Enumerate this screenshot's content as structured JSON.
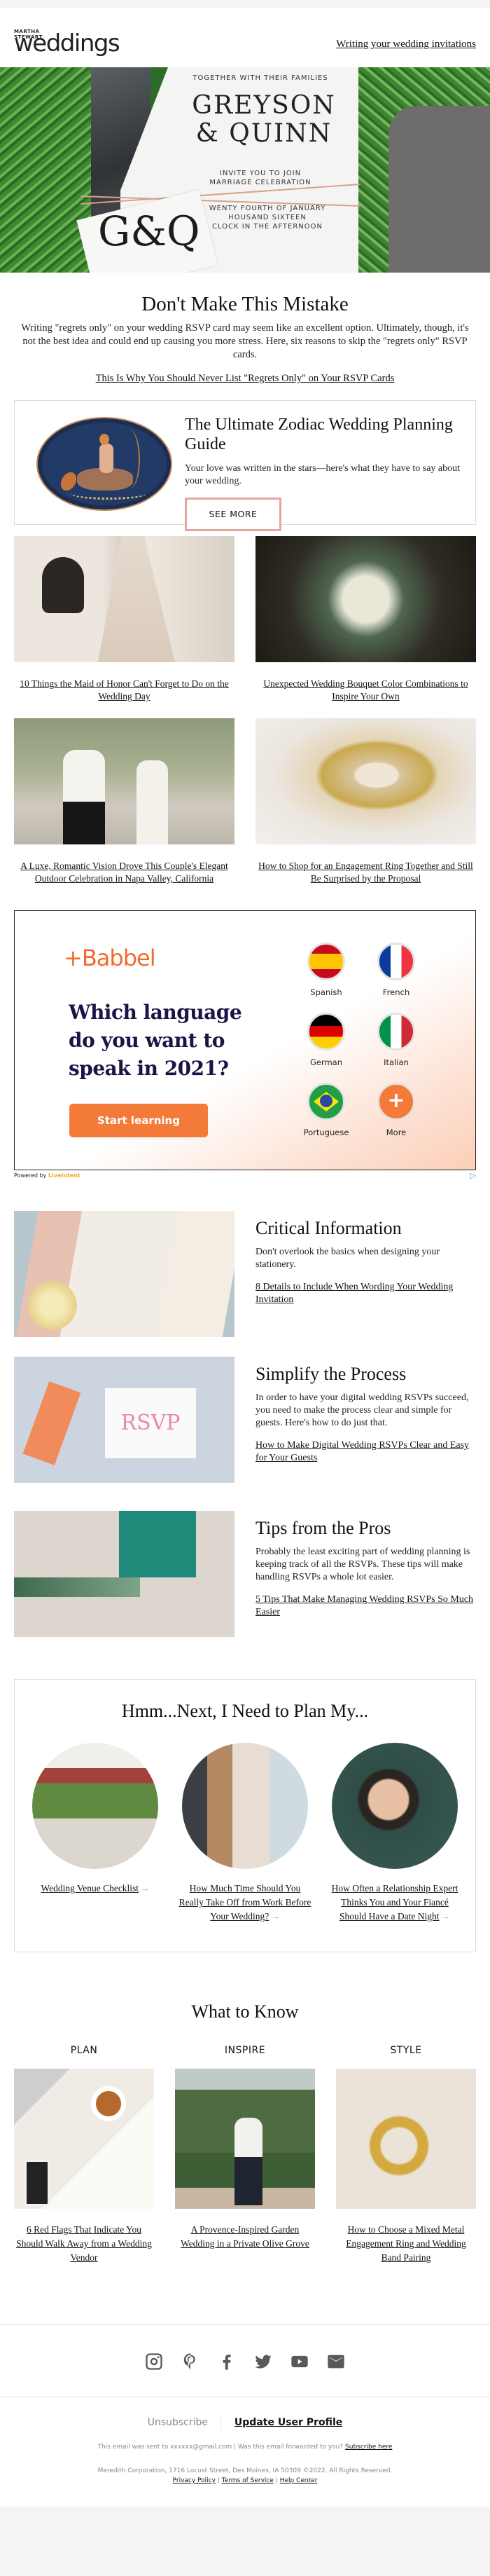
{
  "header": {
    "logo_small_1": "MARTHA",
    "logo_small_2": "STEWART",
    "logo_big": "weddings",
    "nav_link": "Writing your wedding invitations"
  },
  "hero": {
    "card_top": "TOGETHER WITH THEIR FAMILIES",
    "names_1": "GREYSON",
    "names_2": "& QUINN",
    "invite_1": "INVITE YOU TO JOIN",
    "invite_2": "MARRIAGE CELEBRATION",
    "date_1": "WENTY FOURTH OF JANUARY",
    "date_2": "HOUSAND SIXTEEN",
    "date_3": "CLOCK IN THE AFTERNOON",
    "monogram": "G&Q"
  },
  "intro": {
    "title": "Don't Make This Mistake",
    "body": "Writing \"regrets only\" on your wedding RSVP card may seem like an excellent option. Ultimately, though, it's not the best idea and could end up causing you more stress. Here, six reasons to skip the \"regrets only\" RSVP cards.",
    "link": "This Is Why You Should Never List \"Regrets Only\" on Your RSVP Cards"
  },
  "zodiac": {
    "title": "The Ultimate Zodiac Wedding Planning Guide",
    "body": "Your love was written in the stars—here's what they have to say about your wedding.",
    "button": "SEE MORE",
    "button_border_color": "#e4a79c"
  },
  "articles": [
    {
      "caption": "10 Things the Maid of Honor Can't Forget to Do on the Wedding Day"
    },
    {
      "caption": "Unexpected Wedding Bouquet Color Combinations to Inspire Your Own"
    },
    {
      "caption": "A Luxe, Romantic Vision Drove This Couple's Elegant Outdoor Celebration in Napa Valley, California"
    },
    {
      "caption": "How to Shop for an Engagement Ring Together and Still Be Surprised by the Proposal"
    }
  ],
  "ad": {
    "brand": "+Babbel",
    "headline": "Which language do you want to speak in 2021?",
    "cta": "Start learning",
    "accent_color": "#f47a3a",
    "languages": [
      {
        "label": "Spanish"
      },
      {
        "label": "French"
      },
      {
        "label": "German"
      },
      {
        "label": "Italian"
      },
      {
        "label": "Portuguese"
      },
      {
        "label": "More",
        "glyph": "+"
      }
    ],
    "powered_by": "Powered by",
    "powered_brand": "LiveIntent",
    "adchoices_glyph": "▷"
  },
  "features": [
    {
      "title": "Critical Information",
      "body": "Don't overlook the basics when designing your stationery.",
      "link": "8 Details to Include When Wording Your Wedding Invitation"
    },
    {
      "title": "Simplify the Process",
      "body": "In order to have your digital wedding RSVPs succeed, you need to make the process clear and simple for guests. Here's how to do just that.",
      "link": "How to Make Digital Wedding RSVPs Clear and Easy for Your Guests"
    },
    {
      "title": "Tips from the Pros",
      "body": "Probably the least exciting part of wedding planning is keeping track of all the RSVPs. These tips will make handling RSVPs a whole lot easier.",
      "link": "5 Tips That Make Managing Wedding RSVPs So Much Easier"
    }
  ],
  "plan": {
    "title": "Hmm...Next, I Need to Plan My...",
    "arrow": "→",
    "items": [
      {
        "caption": "Wedding Venue Checklist"
      },
      {
        "caption": "How Much Time Should You Really Take Off from Work Before Your Wedding?"
      },
      {
        "caption": "How Often a Relationship Expert Thinks You and Your Fiancé Should Have a Date Night"
      }
    ]
  },
  "what_to_know": {
    "title": "What to Know",
    "items": [
      {
        "category": "PLAN",
        "caption": "6 Red Flags That Indicate You Should Walk Away from a Wedding Vendor"
      },
      {
        "category": "INSPIRE",
        "caption": "A Provence-Inspired Garden Wedding in a Private Olive Grove"
      },
      {
        "category": "STYLE",
        "caption": "How to Choose a Mixed Metal Engagement Ring and Wedding Band Pairing"
      }
    ]
  },
  "footer": {
    "social": [
      "instagram",
      "pinterest",
      "facebook",
      "twitter",
      "youtube",
      "email"
    ],
    "unsubscribe": "Unsubscribe",
    "update_profile": "Update User Profile",
    "sent_to": "This email was sent to xxxxxx@gmail.com  |  Was this email forwarded to you?",
    "subscribe_here": "Subscribe here",
    "address": "Meredith Corporation, 1716 Locust Street, Des Moines, IA 50309 ©2022. All Rights Reserved.",
    "privacy": "Privacy Policy",
    "terms": "Terms of Service",
    "help": "Help Center",
    "sep": "|"
  }
}
